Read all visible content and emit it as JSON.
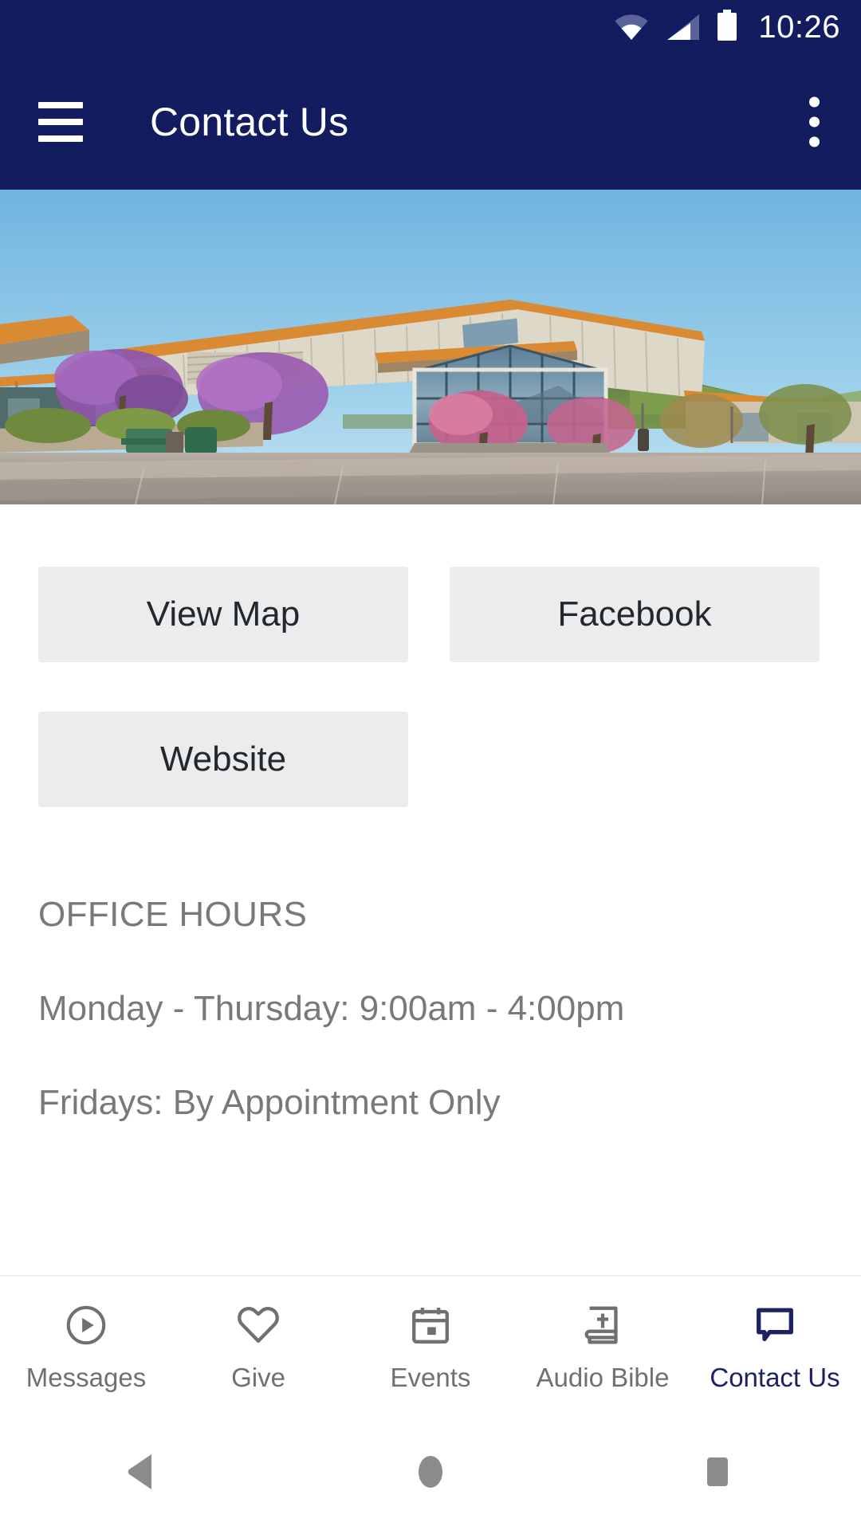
{
  "status_bar": {
    "time": "10:26",
    "icons": [
      "wifi-icon",
      "cellular-signal-icon",
      "battery-icon"
    ]
  },
  "toolbar": {
    "menu_icon": "hamburger-menu-icon",
    "title": "Contact Us",
    "overflow_icon": "more-vertical-icon",
    "background_color": "#141c60",
    "text_color": "#ffffff"
  },
  "hero": {
    "alt": "church building with orange roof trim and green mountain behind",
    "sky_color": "#87c3e8",
    "mountain_color": "#5d7a43",
    "roof_trim_color": "#d98a33"
  },
  "main": {
    "buttons": [
      {
        "label": "View Map",
        "name": "view-map-button"
      },
      {
        "label": "Facebook",
        "name": "facebook-button"
      },
      {
        "label": "Website",
        "name": "website-button"
      }
    ],
    "button_bg": "#ebecee",
    "button_text_color": "#25282b",
    "office_hours_heading": "OFFICE HOURS",
    "office_hours_lines": [
      "Monday - Thursday: 9:00am - 4:00pm",
      "Fridays: By Appointment Only"
    ],
    "body_text_color": "#777a7c"
  },
  "tab_bar": {
    "active_color": "#1b2264",
    "inactive_color": "#6e7173",
    "tabs": [
      {
        "label": "Messages",
        "icon": "play-circle-icon",
        "active": false
      },
      {
        "label": "Give",
        "icon": "heart-icon",
        "active": false
      },
      {
        "label": "Events",
        "icon": "calendar-icon",
        "active": false
      },
      {
        "label": "Audio Bible",
        "icon": "bible-book-icon",
        "active": false
      },
      {
        "label": "Contact Us",
        "icon": "speech-bubble-icon",
        "active": true
      }
    ]
  },
  "system_nav": {
    "buttons": [
      {
        "name": "back-button",
        "icon": "triangle-back-icon"
      },
      {
        "name": "home-button",
        "icon": "circle-home-icon"
      },
      {
        "name": "recents-button",
        "icon": "square-recents-icon"
      }
    ],
    "color": "#8c8c8c"
  }
}
